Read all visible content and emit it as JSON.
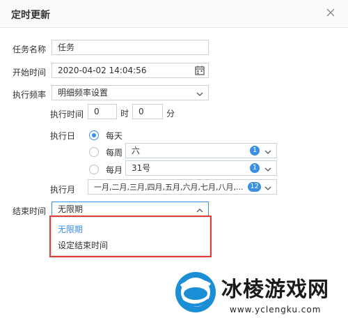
{
  "dialog": {
    "title": "定时更新"
  },
  "form": {
    "task_name_label": "任务名称",
    "task_name_value": "任务",
    "start_time_label": "开始时间",
    "start_time_value": "2020-04-02 14:04:56",
    "frequency_label": "执行频率",
    "frequency_value": "明细频率设置",
    "exec_time_label": "执行时间",
    "exec_hour_value": "0",
    "hour_unit": "时",
    "exec_minute_value": "0",
    "minute_unit": "分",
    "exec_day_label": "执行日",
    "daily_label": "每天",
    "weekly_label": "每周",
    "weekly_value": "六",
    "weekly_count": "1",
    "monthly_label": "每月",
    "monthly_value": "31号",
    "monthly_count": "1",
    "exec_month_label": "执行月",
    "exec_month_value": "一月,二月,三月,四月,五月,六月,七月,八月,...",
    "exec_month_count": "12",
    "end_time_label": "结束时间",
    "end_time_value": "无限期"
  },
  "dropdown": {
    "options": [
      "无限期",
      "设定结束时间"
    ]
  },
  "watermark": {
    "title": "冰棱游戏网",
    "url": "www.yclengku.com"
  },
  "colors": {
    "accent": "#3a8ee6",
    "highlight_box": "#e03c3c"
  },
  "icons": {
    "close": "close-icon",
    "calendar": "calendar-icon",
    "chevron_down": "chevron-down-icon",
    "chevron_up": "chevron-up-icon"
  }
}
